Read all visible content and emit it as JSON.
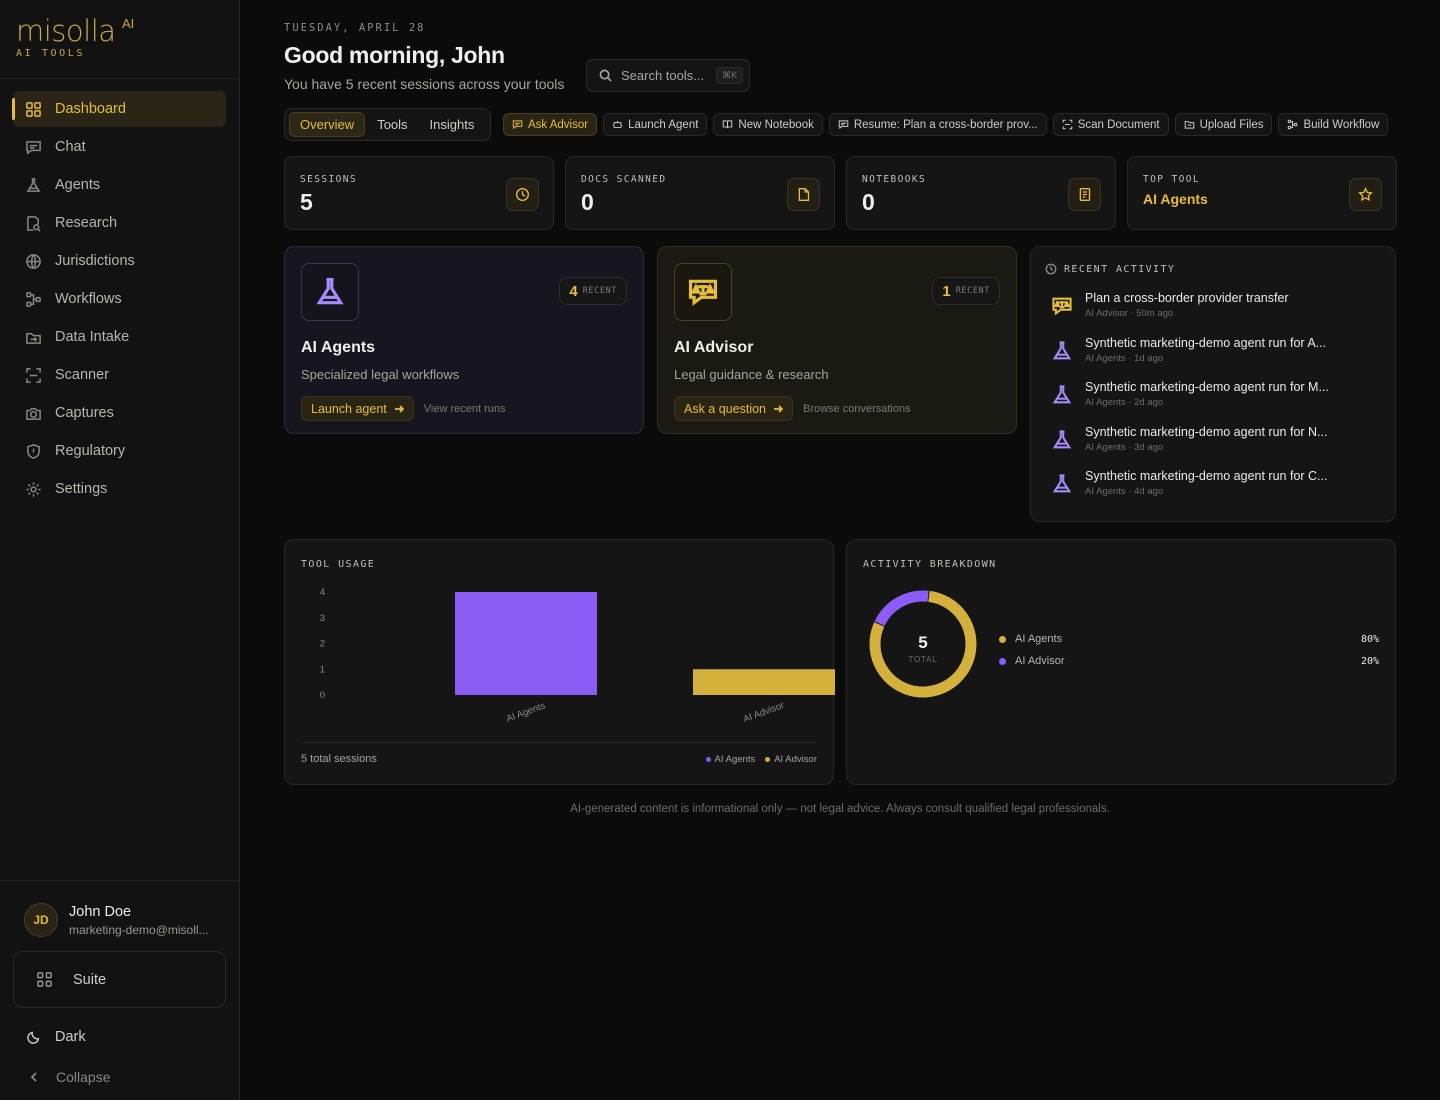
{
  "brand": {
    "word": "misolla",
    "sup": "AI",
    "sub": "AI TOOLS",
    "accent": "#e7bd3c"
  },
  "nav": [
    {
      "label": "Dashboard",
      "icon": "grid-icon",
      "active": true
    },
    {
      "label": "Chat",
      "icon": "chat-icon"
    },
    {
      "label": "Agents",
      "icon": "flask-icon"
    },
    {
      "label": "Research",
      "icon": "research-icon"
    },
    {
      "label": "Jurisdictions",
      "icon": "globe-icon"
    },
    {
      "label": "Workflows",
      "icon": "workflow-icon"
    },
    {
      "label": "Data Intake",
      "icon": "intake-icon"
    },
    {
      "label": "Scanner",
      "icon": "scan-icon"
    },
    {
      "label": "Captures",
      "icon": "camera-icon"
    },
    {
      "label": "Regulatory",
      "icon": "shield-icon"
    },
    {
      "label": "Settings",
      "icon": "gear-icon"
    }
  ],
  "user": {
    "initials": "JD",
    "name": "John Doe",
    "email": "marketing-demo@misoll..."
  },
  "sidebar_bottom": {
    "suite": "Suite",
    "theme": "Dark",
    "collapse": "Collapse"
  },
  "header": {
    "date": "TUESDAY, APRIL 28",
    "greeting": "Good morning, John",
    "subtitle": "You have 5 recent sessions across your tools",
    "search_placeholder": "Search tools...",
    "search_kbd": "⌘K"
  },
  "tabs": [
    {
      "label": "Overview",
      "active": true
    },
    {
      "label": "Tools"
    },
    {
      "label": "Insights"
    }
  ],
  "chips": [
    {
      "label": "Ask Advisor",
      "icon": "chat-icon",
      "gold": true
    },
    {
      "label": "Launch Agent",
      "icon": "bot-icon"
    },
    {
      "label": "New Notebook",
      "icon": "book-icon"
    },
    {
      "label": "Resume: Plan a cross-border prov...",
      "icon": "chat-icon"
    },
    {
      "label": "Scan Document",
      "icon": "scan-icon"
    },
    {
      "label": "Upload Files",
      "icon": "folder-icon"
    },
    {
      "label": "Build Workflow",
      "icon": "workflow-icon"
    }
  ],
  "stats": [
    {
      "label": "SESSIONS",
      "value": "5",
      "icon": "clock-icon"
    },
    {
      "label": "DOCS SCANNED",
      "value": "0",
      "icon": "file-icon"
    },
    {
      "label": "NOTEBOOKS",
      "value": "0",
      "icon": "notebook-icon"
    },
    {
      "label": "TOP TOOL",
      "value": "AI Agents",
      "icon": "star-icon"
    }
  ],
  "tool_cards": [
    {
      "title": "AI Agents",
      "desc": "Specialized legal workflows",
      "count": "4",
      "count_label": "RECENT",
      "action": "Launch agent",
      "link": "View recent runs",
      "icon": "flask-icon"
    },
    {
      "title": "AI Advisor",
      "desc": "Legal guidance & research",
      "count": "1",
      "count_label": "RECENT",
      "action": "Ask a question",
      "link": "Browse conversations",
      "icon": "scales-chat-icon"
    }
  ],
  "activity": {
    "title": "RECENT ACTIVITY",
    "items": [
      {
        "title": "Plan a cross-border provider transfer",
        "meta": "AI Advisor · 50m ago",
        "icon": "scales-chat-icon"
      },
      {
        "title": "Synthetic marketing-demo agent run for A...",
        "meta": "AI Agents · 1d ago",
        "icon": "flask-icon"
      },
      {
        "title": "Synthetic marketing-demo agent run for M...",
        "meta": "AI Agents · 2d ago",
        "icon": "flask-icon"
      },
      {
        "title": "Synthetic marketing-demo agent run for N...",
        "meta": "AI Agents · 3d ago",
        "icon": "flask-icon"
      },
      {
        "title": "Synthetic marketing-demo agent run for C...",
        "meta": "AI Agents · 4d ago",
        "icon": "flask-icon"
      }
    ]
  },
  "usage": {
    "title": "TOOL USAGE",
    "footer": "5 total sessions",
    "legend": [
      "AI Agents",
      "AI Advisor"
    ]
  },
  "breakdown": {
    "title": "ACTIVITY BREAKDOWN",
    "total": "5",
    "total_label": "TOTAL",
    "rows": [
      {
        "label": "AI Agents",
        "pct": "80%",
        "color": "#d4b03d"
      },
      {
        "label": "AI Advisor",
        "pct": "20%",
        "color": "#8b5cf6"
      }
    ]
  },
  "chart_data": [
    {
      "type": "bar",
      "categories": [
        "AI Agents",
        "AI Advisor"
      ],
      "values": [
        4,
        1
      ],
      "colors": [
        "#8b5cf6",
        "#d4b03d"
      ],
      "yticks": [
        0,
        1,
        2,
        3,
        4
      ],
      "ylim": [
        0,
        4
      ],
      "title": "TOOL USAGE"
    },
    {
      "type": "pie",
      "categories": [
        "AI Agents",
        "AI Advisor"
      ],
      "values": [
        80,
        20
      ],
      "colors": [
        "#d4b03d",
        "#8b5cf6"
      ],
      "title": "ACTIVITY BREAKDOWN"
    }
  ],
  "disclaimer": "AI-generated content is informational only — not legal advice. Always consult qualified legal professionals."
}
